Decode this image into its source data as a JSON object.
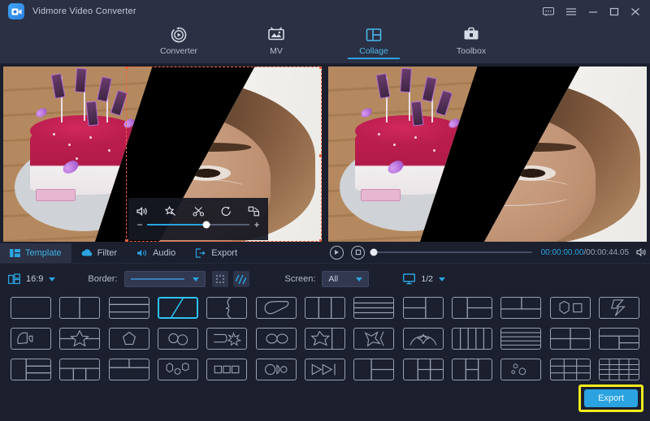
{
  "window": {
    "app_title": "Vidmore Video Converter",
    "logo_icon": "video-camera-icon",
    "controls": [
      {
        "name": "feedback-icon",
        "label": "feedback"
      },
      {
        "name": "menu-icon",
        "label": "menu"
      },
      {
        "name": "minimize-icon",
        "label": "minimize"
      },
      {
        "name": "maximize-icon",
        "label": "maximize"
      },
      {
        "name": "close-icon",
        "label": "close"
      }
    ]
  },
  "nav": {
    "active": "Collage",
    "tabs": [
      {
        "label": "Converter",
        "icon": "converter-icon"
      },
      {
        "label": "MV",
        "icon": "mv-icon"
      },
      {
        "label": "Collage",
        "icon": "collage-icon"
      },
      {
        "label": "Toolbox",
        "icon": "toolbox-icon"
      }
    ]
  },
  "clip_toolbar": {
    "icons": [
      {
        "name": "volume-icon",
        "label": "Volume"
      },
      {
        "name": "magic-wand-icon",
        "label": "Enhance"
      },
      {
        "name": "scissors-icon",
        "label": "Trim"
      },
      {
        "name": "rotate-icon",
        "label": "Rotate"
      },
      {
        "name": "crop-icon",
        "label": "Crop"
      }
    ],
    "zoom_minus": "−",
    "zoom_plus": "+",
    "zoom_value": 58
  },
  "edit_tabs": {
    "active": "Template",
    "items": [
      {
        "label": "Template",
        "icon": "template-icon"
      },
      {
        "label": "Filter",
        "icon": "filter-icon"
      },
      {
        "label": "Audio",
        "icon": "audio-icon"
      },
      {
        "label": "Export",
        "icon": "export-icon"
      }
    ]
  },
  "player": {
    "play_icon": "play-icon",
    "stop_icon": "stop-icon",
    "current_time": "00:00:00.00",
    "separator": "/",
    "total_time": "00:00:44.05",
    "volume_icon": "speaker-icon",
    "progress_percent": 0
  },
  "options": {
    "ratio_icon": "aspect-ratio-icon",
    "ratio_value": "16:9",
    "border_label": "Border:",
    "border_style_icon": "solid-line-icon",
    "border_dots_icon": "dotted-pattern-icon",
    "border_stripes_icon": "striped-pattern-icon",
    "screen_label": "Screen:",
    "screen_value": "All",
    "page_icon": "monitor-icon",
    "page_value": "1/2"
  },
  "templates": {
    "selected_index": 3,
    "count": 39,
    "items": [
      {
        "id": "t1",
        "name": "single-pane"
      },
      {
        "id": "t2",
        "name": "vertical-split-2"
      },
      {
        "id": "t3",
        "name": "horizontal-split-2"
      },
      {
        "id": "t4",
        "name": "diagonal-split-2"
      },
      {
        "id": "t5",
        "name": "notch-split-2"
      },
      {
        "id": "t6",
        "name": "rounded-shape-2"
      },
      {
        "id": "t7",
        "name": "vertical-split-3"
      },
      {
        "id": "t8",
        "name": "horizontal-split-3"
      },
      {
        "id": "t9",
        "name": "left-stack-3"
      },
      {
        "id": "t10",
        "name": "right-stack-3"
      },
      {
        "id": "t11",
        "name": "top-split-3"
      },
      {
        "id": "t12",
        "name": "hexagon-square-2"
      },
      {
        "id": "t13",
        "name": "lightning-split-2"
      },
      {
        "id": "t14",
        "name": "double-heart-2"
      },
      {
        "id": "t15",
        "name": "megaphone-shape-2"
      },
      {
        "id": "t16",
        "name": "star-overlay-3"
      },
      {
        "id": "t17",
        "name": "pentagon-center-2"
      },
      {
        "id": "t18",
        "name": "two-circles-2"
      },
      {
        "id": "t19",
        "name": "tag-sun-2"
      },
      {
        "id": "t20",
        "name": "oval-pair-2"
      },
      {
        "id": "t21",
        "name": "star-corner-3"
      },
      {
        "id": "t22",
        "name": "burst-split-2"
      },
      {
        "id": "t23",
        "name": "arch-cross-2"
      },
      {
        "id": "t24",
        "name": "vertical-split-5"
      },
      {
        "id": "t25",
        "name": "horizontal-split-4"
      },
      {
        "id": "t26",
        "name": "quad-grid-4"
      },
      {
        "id": "t27",
        "name": "left-big-quad-4"
      },
      {
        "id": "t28",
        "name": "top-wide-quad-4"
      },
      {
        "id": "t29",
        "name": "stack-right-3"
      },
      {
        "id": "t30",
        "name": "left-big-stack-3"
      },
      {
        "id": "t31",
        "name": "bottom-split-3"
      },
      {
        "id": "t32",
        "name": "top-wide-bottom-2"
      },
      {
        "id": "t33",
        "name": "three-hex-3"
      },
      {
        "id": "t34",
        "name": "three-squares-3"
      },
      {
        "id": "t35",
        "name": "circle-row-3"
      },
      {
        "id": "t36",
        "name": "arrow-strip-3"
      },
      {
        "id": "t37",
        "name": "left-split-3"
      },
      {
        "id": "t38",
        "name": "quad-uneven-4"
      },
      {
        "id": "t39",
        "name": "left-big-grid-5"
      },
      {
        "id": "t40",
        "name": "bubbles-3"
      },
      {
        "id": "t41",
        "name": "grid-6"
      },
      {
        "id": "t42",
        "name": "grid-9"
      },
      {
        "id": "t43",
        "name": "grid-12"
      }
    ]
  },
  "export": {
    "label": "Export",
    "highlight_color": "#f5ec1d",
    "button_color": "#2ba3e0"
  },
  "colors": {
    "accent": "#2ba3e0",
    "bg": "#1b1f2e",
    "panel": "#2b3044",
    "selection": "#f0643c",
    "text": "#c3c8d6"
  }
}
